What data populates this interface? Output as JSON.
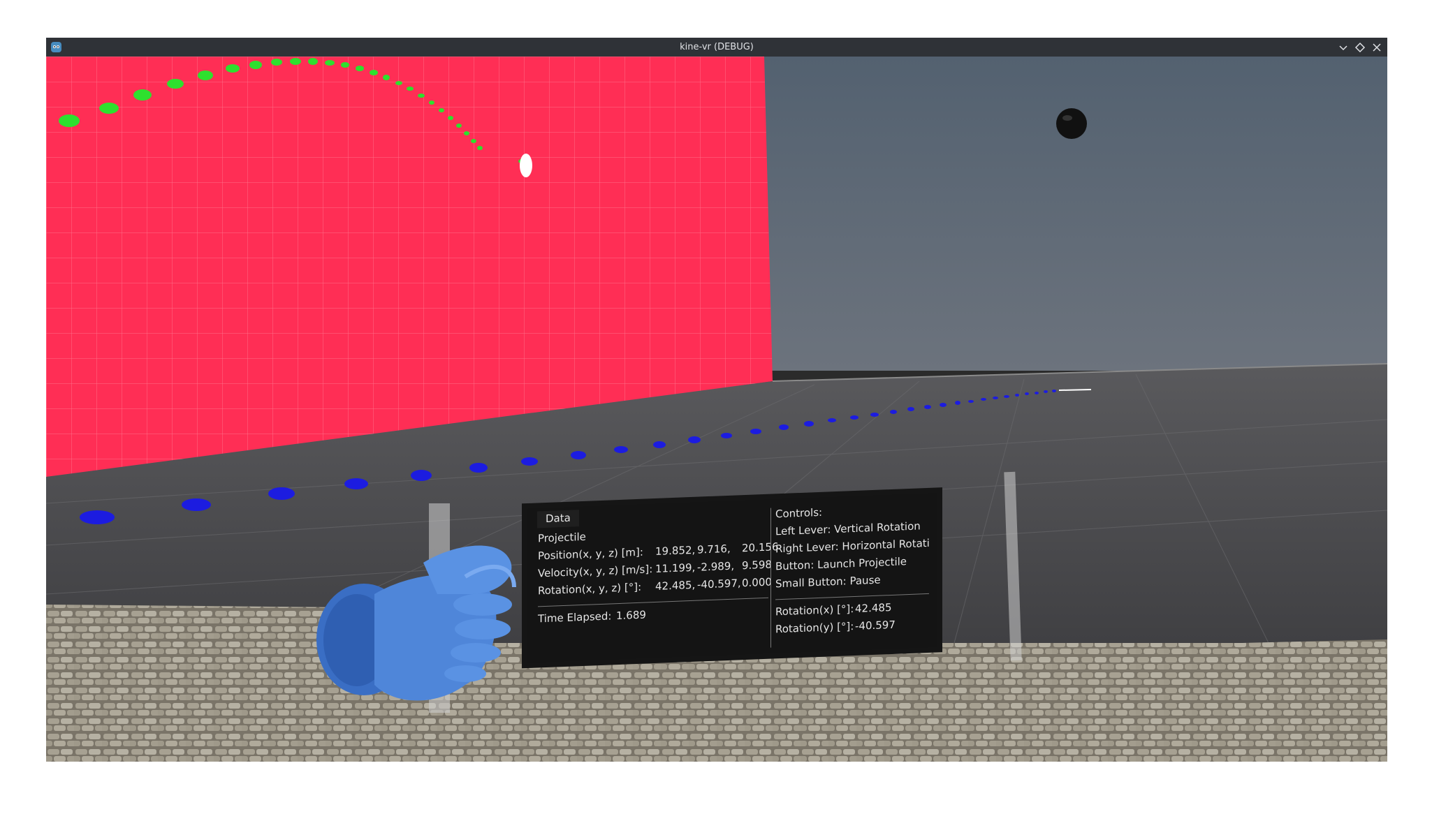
{
  "window": {
    "title": "kine-vr (DEBUG)",
    "controls": [
      "minimize",
      "maximize",
      "close"
    ]
  },
  "hud": {
    "tab_label": "Data",
    "projectile": {
      "heading": "Projectile",
      "position": {
        "label": "Position(x, y, z) [m]:",
        "x": "19.852,",
        "y": "9.716,",
        "z": "20.156"
      },
      "velocity": {
        "label": "Velocity(x, y, z) [m/s]:",
        "x": "11.199,",
        "y": "-2.989,",
        "z": "9.598"
      },
      "rotation": {
        "label": "Rotation(x, y, z) [°]:",
        "x": "42.485,",
        "y": "-40.597,",
        "z": "0.000"
      }
    },
    "time_elapsed": {
      "label": "Time Elapsed:",
      "value": "1.689"
    },
    "controls": {
      "heading": "Controls:",
      "items": [
        "Left Lever: Vertical Rotation",
        "Right Lever: Horizontal Rotati",
        "Button: Launch Projectile",
        "Small Button: Pause"
      ]
    },
    "launcher": {
      "rotation_x": {
        "label": "Rotation(x) [°]:",
        "value": "42.485"
      },
      "rotation_y": {
        "label": "Rotation(y) [°]:",
        "value": "-40.597"
      }
    }
  },
  "scene": {
    "wall_color": "#ff2e55",
    "sky_color": "#5a6675",
    "floor_color": "#4a4a4d",
    "trajectory_color": "#2ee02e",
    "ground_trace_color": "#1c1ce0",
    "hand_color": "#4f86d9"
  }
}
